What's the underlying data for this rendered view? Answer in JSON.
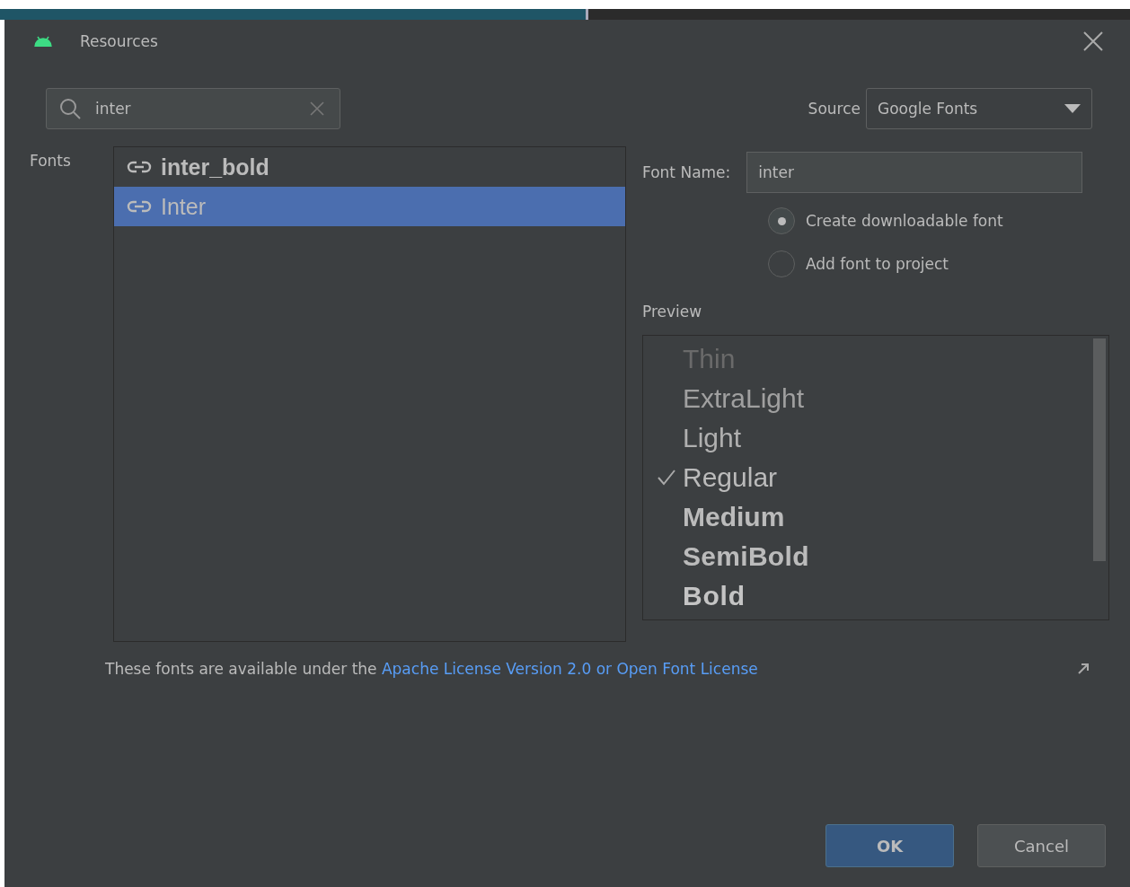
{
  "window": {
    "title": "Resources"
  },
  "search": {
    "value": "inter"
  },
  "source": {
    "label": "Source",
    "value": "Google Fonts"
  },
  "fonts": {
    "label": "Fonts",
    "items": [
      {
        "name": "inter_bold",
        "kind": "bold",
        "selected": false
      },
      {
        "name": "Inter",
        "kind": "regular",
        "selected": true
      }
    ]
  },
  "font_name": {
    "label": "Font Name:",
    "value": "inter"
  },
  "options": [
    {
      "label": "Create downloadable font",
      "selected": true
    },
    {
      "label": "Add font to project",
      "selected": false
    }
  ],
  "preview": {
    "label": "Preview",
    "items": [
      {
        "name": "Thin",
        "kind": "thin",
        "selected": false
      },
      {
        "name": "ExtraLight",
        "kind": "extralight",
        "selected": false
      },
      {
        "name": "Light",
        "kind": "light",
        "selected": false
      },
      {
        "name": "Regular",
        "kind": "regular",
        "selected": true
      },
      {
        "name": "Medium",
        "kind": "medium",
        "selected": false
      },
      {
        "name": "SemiBold",
        "kind": "semibold",
        "selected": false
      },
      {
        "name": "Bold",
        "kind": "bold",
        "selected": false
      }
    ]
  },
  "license": {
    "text": "These fonts are available under the ",
    "link": "Apache License Version 2.0 or Open Font License"
  },
  "buttons": [
    {
      "label": "OK",
      "kind": "primary"
    },
    {
      "label": "Cancel",
      "kind": "secondary"
    }
  ]
}
